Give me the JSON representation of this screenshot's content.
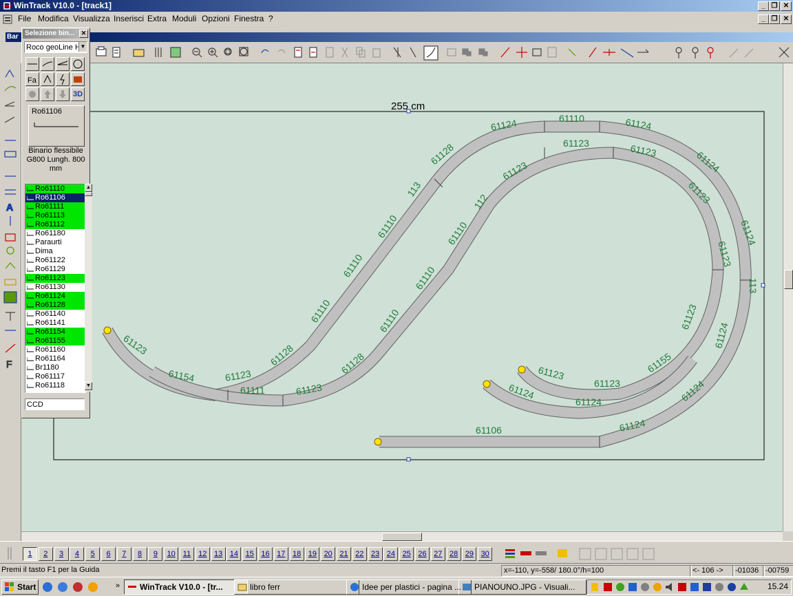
{
  "window": {
    "title": "WinTrack  V10.0 - [track1]",
    "icon": "wintrack-app-icon"
  },
  "menu": [
    "File",
    "Modifica",
    "Visualizza",
    "Inserisci",
    "Extra",
    "Moduli",
    "Opzioni",
    "Finestra",
    "?"
  ],
  "inner_window_title": "Bar",
  "palette": {
    "title": "Selezione bin...",
    "library": "Roco geoLine H",
    "selected_code": "Ro61106",
    "description": "Binario flessibile G800 Lungh. 800 mm",
    "filter_value": "CCD",
    "button_3d_label": "3D",
    "items": [
      {
        "label": "Ro61110",
        "state": "on"
      },
      {
        "label": "Ro61106",
        "state": "selected"
      },
      {
        "label": "Ro61111",
        "state": "on"
      },
      {
        "label": "Ro61113",
        "state": "on"
      },
      {
        "label": "Ro61112",
        "state": "on"
      },
      {
        "label": "Ro61180",
        "state": ""
      },
      {
        "label": "Paraurti",
        "state": ""
      },
      {
        "label": "Dima",
        "state": ""
      },
      {
        "label": "Ro61122",
        "state": ""
      },
      {
        "label": "Ro61129",
        "state": ""
      },
      {
        "label": "Ro61123",
        "state": "on"
      },
      {
        "label": "Ro61130",
        "state": ""
      },
      {
        "label": "Ro61124",
        "state": "on"
      },
      {
        "label": "Ro61128",
        "state": "on"
      },
      {
        "label": "Ro61140",
        "state": ""
      },
      {
        "label": "Ro61141",
        "state": ""
      },
      {
        "label": "Ro61154",
        "state": "on"
      },
      {
        "label": "Ro61155",
        "state": "on"
      },
      {
        "label": "Ro61160",
        "state": ""
      },
      {
        "label": "Ro61164",
        "state": ""
      },
      {
        "label": "Br1180",
        "state": ""
      },
      {
        "label": "Ro61117",
        "state": ""
      },
      {
        "label": "Ro61118",
        "state": ""
      }
    ]
  },
  "drawing": {
    "dimension_label": "255 cm",
    "track_labels": [
      "61110",
      "61124",
      "61124",
      "61128",
      "61124",
      "113",
      "61110",
      "61124",
      "61110",
      "61110",
      "61123",
      "61154",
      "61111",
      "61123",
      "61128",
      "61123",
      "61128",
      "61110",
      "61110",
      "61110",
      "112",
      "61123",
      "61123",
      "61123",
      "61123",
      "61123",
      "113",
      "61123",
      "61124",
      "61155",
      "61123",
      "61123",
      "61124",
      "61124",
      "61106",
      "61124",
      "61124"
    ]
  },
  "layers": [
    "1",
    "2",
    "3",
    "4",
    "5",
    "6",
    "7",
    "8",
    "9",
    "10",
    "11",
    "12",
    "13",
    "14",
    "15",
    "16",
    "17",
    "18",
    "19",
    "20",
    "21",
    "22",
    "23",
    "24",
    "25",
    "26",
    "27",
    "28",
    "29",
    "30"
  ],
  "status": {
    "hint": "Premi il tasto F1 per la Guida",
    "coords": "x=-110, y=-558/ 180.0°/h=100",
    "nav": "<- 106 ->",
    "val1": "-01036",
    "val2": "-00759"
  },
  "taskbar": {
    "start": "Start",
    "tasks": [
      "WinTrack  V10.0 - [tr...",
      "libro ferr",
      "Idee per plastici - pagina ...",
      "PIANOUNO.JPG - Visuali..."
    ],
    "clock": "15.24"
  },
  "colors": {
    "titlebar": "#0a246a",
    "canvas": "#cfe0d6",
    "track_fill": "#c0c0c0",
    "label_green": "#1f7a3a",
    "list_highlight": "#00e600",
    "endpoint": "#ffe400"
  }
}
